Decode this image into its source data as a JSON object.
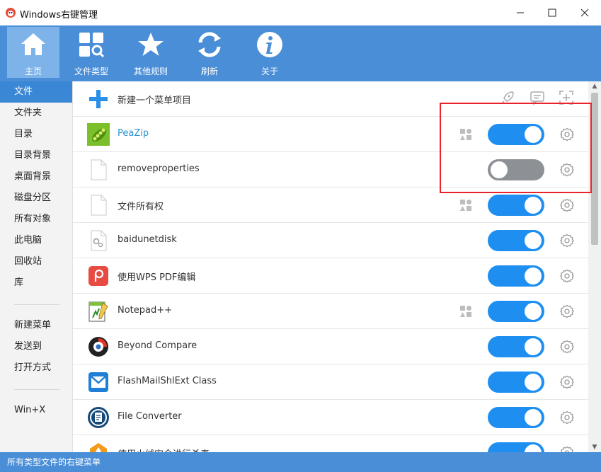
{
  "window": {
    "title": "Windows右键管理"
  },
  "toolbar": {
    "buttons": [
      {
        "label": "主页",
        "icon": "home-icon"
      },
      {
        "label": "文件类型",
        "icon": "file-types-icon"
      },
      {
        "label": "其他规则",
        "icon": "star-icon"
      },
      {
        "label": "刷新",
        "icon": "refresh-icon"
      },
      {
        "label": "关于",
        "icon": "info-icon"
      }
    ]
  },
  "sidebar": {
    "items": [
      "文件",
      "文件夹",
      "目录",
      "目录背景",
      "桌面背景",
      "磁盘分区",
      "所有对象",
      "此电脑",
      "回收站",
      "库",
      "新建菜单",
      "发送到",
      "打开方式",
      "Win+X"
    ],
    "active": "文件"
  },
  "list": {
    "new_item_label": "新建一个菜单项目",
    "rows": [
      {
        "label": "PeaZip",
        "enabled": true
      },
      {
        "label": "removeproperties",
        "enabled": false
      },
      {
        "label": "文件所有权",
        "enabled": true
      },
      {
        "label": "baidunetdisk",
        "enabled": true
      },
      {
        "label": "使用WPS PDF编辑",
        "enabled": true
      },
      {
        "label": "Notepad++",
        "enabled": true
      },
      {
        "label": "Beyond Compare",
        "enabled": true
      },
      {
        "label": "FlashMailShlExt Class",
        "enabled": true
      },
      {
        "label": "File Converter",
        "enabled": true
      },
      {
        "label": "使用火绒安全进行杀毒",
        "enabled": true
      }
    ]
  },
  "statusbar": {
    "text": "所有类型文件的右键菜单"
  },
  "colors": {
    "accent": "#4a8ed8",
    "toggle_on": "#1e8ff0",
    "toggle_off": "#8d9095",
    "annotation": "#e8242a"
  }
}
